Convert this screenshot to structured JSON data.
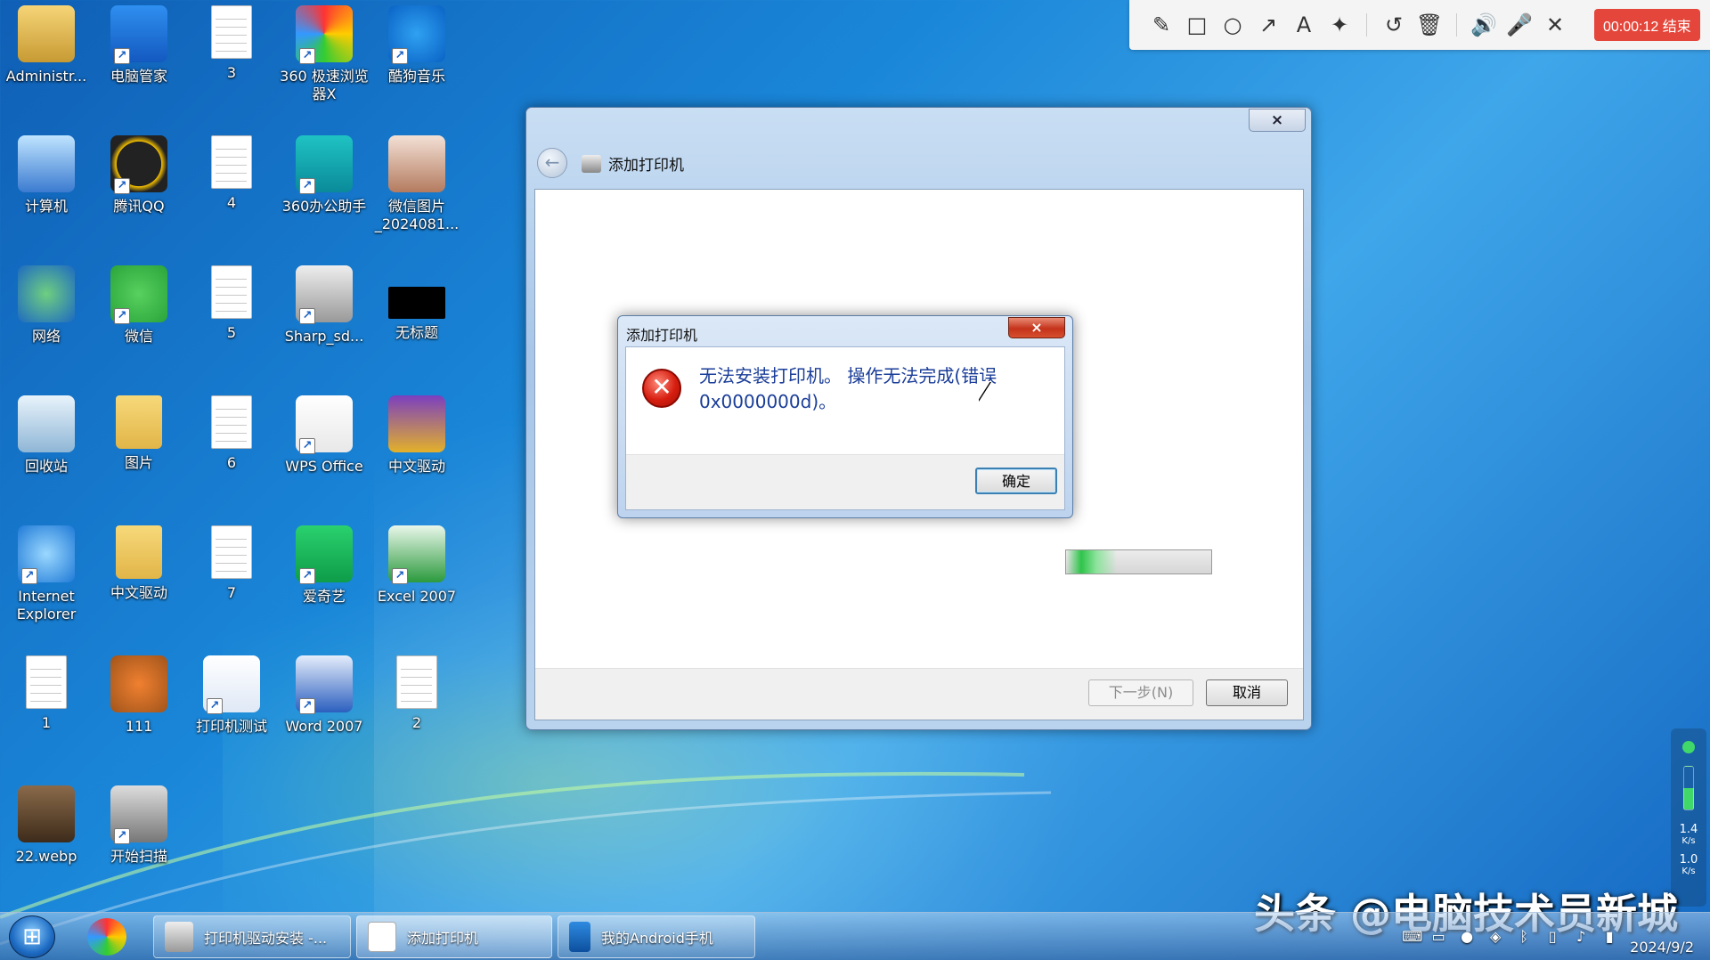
{
  "desktop": {
    "icons": [
      {
        "label": "Administr...",
        "icon": "user-folder-icon"
      },
      {
        "label": "电脑管家",
        "icon": "shield-app-icon"
      },
      {
        "label": "3",
        "icon": "document-icon"
      },
      {
        "label": "360 极速浏览器X",
        "icon": "browser-icon"
      },
      {
        "label": "酷狗音乐",
        "icon": "music-app-icon"
      },
      {
        "label": "计算机",
        "icon": "computer-icon"
      },
      {
        "label": "腾讯QQ",
        "icon": "qq-icon"
      },
      {
        "label": "4",
        "icon": "document-icon"
      },
      {
        "label": "360办公助手",
        "icon": "office-helper-icon"
      },
      {
        "label": "微信图片_2024081...",
        "icon": "image-file-icon"
      },
      {
        "label": "网络",
        "icon": "network-icon"
      },
      {
        "label": "微信",
        "icon": "wechat-icon"
      },
      {
        "label": "5",
        "icon": "document-icon"
      },
      {
        "label": "Sharp_sd...",
        "icon": "printer-app-icon"
      },
      {
        "label": "无标题",
        "icon": "black-image-icon"
      },
      {
        "label": "回收站",
        "icon": "recycle-bin-icon"
      },
      {
        "label": "图片",
        "icon": "pictures-folder-icon"
      },
      {
        "label": "6",
        "icon": "document-icon"
      },
      {
        "label": "WPS Office",
        "icon": "wps-icon"
      },
      {
        "label": "中文驱动",
        "icon": "archive-icon"
      },
      {
        "label": "Internet Explorer",
        "icon": "ie-icon"
      },
      {
        "label": "中文驱动",
        "icon": "folder-icon"
      },
      {
        "label": "7",
        "icon": "document-icon"
      },
      {
        "label": "爱奇艺",
        "icon": "iqiyi-icon"
      },
      {
        "label": "Excel 2007",
        "icon": "excel-icon"
      },
      {
        "label": "1",
        "icon": "document-icon"
      },
      {
        "label": "111",
        "icon": "food-image-icon"
      },
      {
        "label": "打印机测试",
        "icon": "word-doc-icon"
      },
      {
        "label": "Word 2007",
        "icon": "word-icon"
      },
      {
        "label": "2",
        "icon": "document-icon"
      },
      {
        "label": "22.webp",
        "icon": "photo-icon"
      },
      {
        "label": "开始扫描",
        "icon": "scanner-icon"
      }
    ]
  },
  "recorder_toolbar": {
    "tools": [
      "pencil-icon",
      "rectangle-icon",
      "circle-icon",
      "arrow-icon",
      "text-icon",
      "magic-wand-icon",
      "undo-icon",
      "trash-icon",
      "speaker-icon",
      "microphone-icon",
      "close-icon"
    ],
    "tool_glyphs": [
      "✎",
      "□",
      "○",
      "↗",
      "A",
      "✦",
      "↺",
      "🗑",
      "🔊",
      "🎤",
      "✕"
    ],
    "timer": "00:00:12 结束",
    "timer_color": "#e5463b"
  },
  "main_window": {
    "title": "添加打印机",
    "close_label": "×",
    "progress_fraction": 0.35,
    "next_button": "下一步(N)",
    "cancel_button": "取消"
  },
  "error_dialog": {
    "title": "添加打印机",
    "close_label": "×",
    "message": "无法安装打印机。 操作无法完成(错误 0x0000000d)。",
    "ok_button": "确定",
    "icon": "error-icon"
  },
  "taskbar": {
    "start_icon": "windows-logo-icon",
    "pinned": [
      "360-browser-icon"
    ],
    "items": [
      {
        "label": "打印机驱动安装 -...",
        "icon": "installer-icon",
        "active": false
      },
      {
        "label": "添加打印机",
        "icon": "printer-window-icon",
        "active": true
      },
      {
        "label": "我的Android手机",
        "icon": "phone-icon",
        "active": false
      }
    ],
    "tray_icons": [
      "keyboard-icon",
      "monitor-icon",
      "qq-tray-icon",
      "shield-tray-icon",
      "bluetooth-icon",
      "battery-icon",
      "volume-icon",
      "signal-icon"
    ],
    "date": "2024/9/2"
  },
  "net_widget": {
    "upload": "1.4",
    "upload_unit": "K/s",
    "download": "1.0",
    "download_unit": "K/s"
  },
  "watermark": "头条 @电脑技术员新城"
}
